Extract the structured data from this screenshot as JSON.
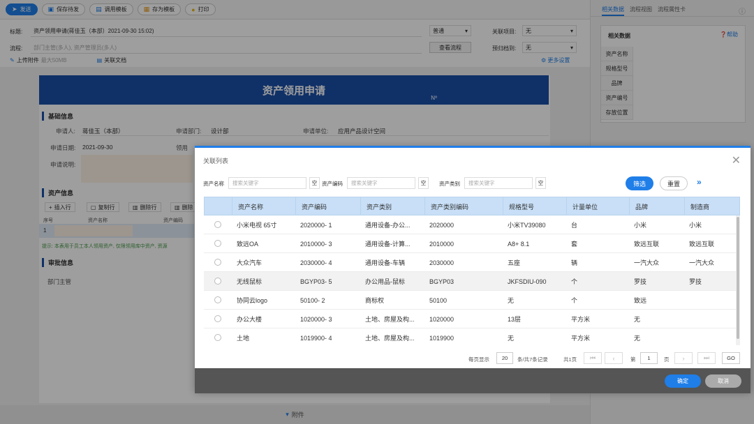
{
  "toolbar": {
    "buttons": [
      {
        "label": "发送",
        "icon": "send-icon"
      },
      {
        "label": "保存待发",
        "icon": "save-icon"
      },
      {
        "label": "调用模板",
        "icon": "template-icon"
      },
      {
        "label": "存为模板",
        "icon": "save-template-icon"
      },
      {
        "label": "打印",
        "icon": "print-icon"
      }
    ]
  },
  "header": {
    "title_label": "标题:",
    "title_value": "资产领用申请(蒋佳玉（本部）2021-09-30 15:02)",
    "priority_value": "普通",
    "related_label": "关联项目:",
    "related_value": "无",
    "flow_label": "流程:",
    "flow_placeholder": "部门主管(多人), 资产管理员(多人)",
    "view_flow_button": "查看流程",
    "deadline_label": "预归档到:",
    "deadline_value": "无",
    "upload_label": "上传附件",
    "upload_hint": "最大50MB",
    "related_doc_label": "关联文档",
    "more_settings": "更多设置"
  },
  "form": {
    "banner_title": "资产领用申请",
    "banner_no": "Nº",
    "section_basic": "基础信息",
    "applicant_label": "申请人:",
    "applicant_value": "蒋佳玉（本部）",
    "dept_label": "申请部门:",
    "dept_value": "设计部",
    "unit_label": "申请单位:",
    "unit_value": "应用产品设计空间",
    "date_label": "申请日期:",
    "date_value": "2021-09-30",
    "use_label": "领用",
    "desc_label": "申请说明:",
    "section_asset": "资产信息",
    "btn_insert": "插入行",
    "btn_copy": "复制行",
    "btn_delete": "删除行",
    "btn_delete2": "删除",
    "col_seq": "序号",
    "col_name": "资产名称",
    "col_code": "资产编码",
    "row_seq": "1",
    "tip": "提示: 本表用于员工本人领用资产, 仅限领用库中资产, 资源",
    "section_approve": "审批信息",
    "approve_dept": "部门主管",
    "attachments": "附件"
  },
  "right_panel": {
    "tabs": [
      "相关数据",
      "流程视图",
      "流程属性卡"
    ],
    "box_title": "相关数据",
    "help": "帮助",
    "rows": [
      "资产名称",
      "规格型号",
      "品牌",
      "资产编号",
      "存放位置"
    ]
  },
  "modal": {
    "title": "关联列表",
    "filters": [
      {
        "label": "资产名称",
        "placeholder": "搜索关键字"
      },
      {
        "label": "资产编码",
        "placeholder": "搜索关键字"
      },
      {
        "label": "资产类别",
        "placeholder": "搜索关键字"
      }
    ],
    "empty_label": "空",
    "filter_button": "筛选",
    "reset_button": "重置",
    "more_icon": "»",
    "columns": [
      "资产名称",
      "资产编码",
      "资产类别",
      "资产类别编码",
      "规格型号",
      "计量单位",
      "品牌",
      "制造商"
    ],
    "rows": [
      [
        "小米电视 65寸",
        "2020000- 1",
        "通用设备-办公...",
        "2020000",
        "小米TV39080",
        "台",
        "小米",
        "小米"
      ],
      [
        "致远OA",
        "2010000- 3",
        "通用设备-计算...",
        "2010000",
        "A8+ 8.1",
        "套",
        "致远互联",
        "致远互联"
      ],
      [
        "大众汽车",
        "2030000- 4",
        "通用设备-车辆",
        "2030000",
        "五座",
        "辆",
        "一汽大众",
        "一汽大众"
      ],
      [
        "无线鼠标",
        "BGYP03- 5",
        "办公用品-鼠标",
        "BGYP03",
        "JKFSDIU-090",
        "个",
        "罗技",
        "罗技"
      ],
      [
        "协同云logo",
        "50100- 2",
        "商标权",
        "50100",
        "无",
        "个",
        "致远",
        ""
      ],
      [
        "办公大楼",
        "1020000- 3",
        "土地、房屋及构...",
        "1020000",
        "13层",
        "平方米",
        "无",
        ""
      ],
      [
        "土地",
        "1019900- 4",
        "土地、房屋及构...",
        "1019900",
        "无",
        "平方米",
        "无",
        ""
      ]
    ],
    "pager": {
      "per_page_label": "每页显示",
      "per_page_value": "20",
      "total_label": "条/共7条记录",
      "pages_label": "共1页",
      "page_prefix": "第",
      "page_value": "1",
      "page_suffix": "页",
      "go_label": "GO"
    },
    "ok_button": "确定",
    "cancel_button": "取消"
  }
}
